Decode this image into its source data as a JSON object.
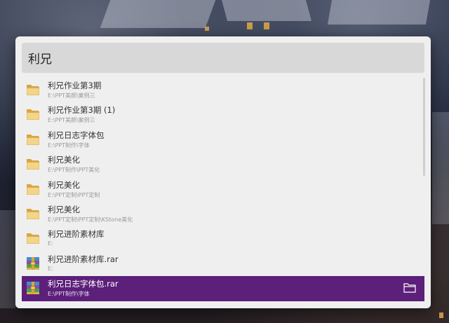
{
  "search": {
    "query": "利兄"
  },
  "results": [
    {
      "title": "利兄作业第3期",
      "path": "E:\\PPT美颜\\案例三",
      "icon": "folder-icon"
    },
    {
      "title": "利兄作业第3期 (1)",
      "path": "E:\\PPT美颜\\案例三",
      "icon": "folder-icon"
    },
    {
      "title": "利兄日志字体包",
      "path": "E:\\PPT制作\\字体",
      "icon": "folder-icon"
    },
    {
      "title": "利兄美化",
      "path": "E:\\PPT制作\\PPT美化",
      "icon": "folder-icon"
    },
    {
      "title": "利兄美化",
      "path": "E:\\PPT定制\\PPT定制",
      "icon": "folder-icon"
    },
    {
      "title": "利兄美化",
      "path": "E:\\PPT定制\\PPT定制\\KStone美化",
      "icon": "folder-icon"
    },
    {
      "title": "利兄进阶素材库",
      "path": "E:",
      "icon": "folder-icon"
    },
    {
      "title": "利兄进阶素材库.rar",
      "path": "E:",
      "icon": "archive-icon"
    },
    {
      "title": "利兄日志字体包.rar",
      "path": "E:\\PPT制作\\字体",
      "icon": "archive-icon"
    }
  ],
  "selected_index": 8,
  "colors": {
    "selection": "#5c1f7a",
    "panel": "#efefef",
    "search_bar": "#d8d8d8"
  }
}
